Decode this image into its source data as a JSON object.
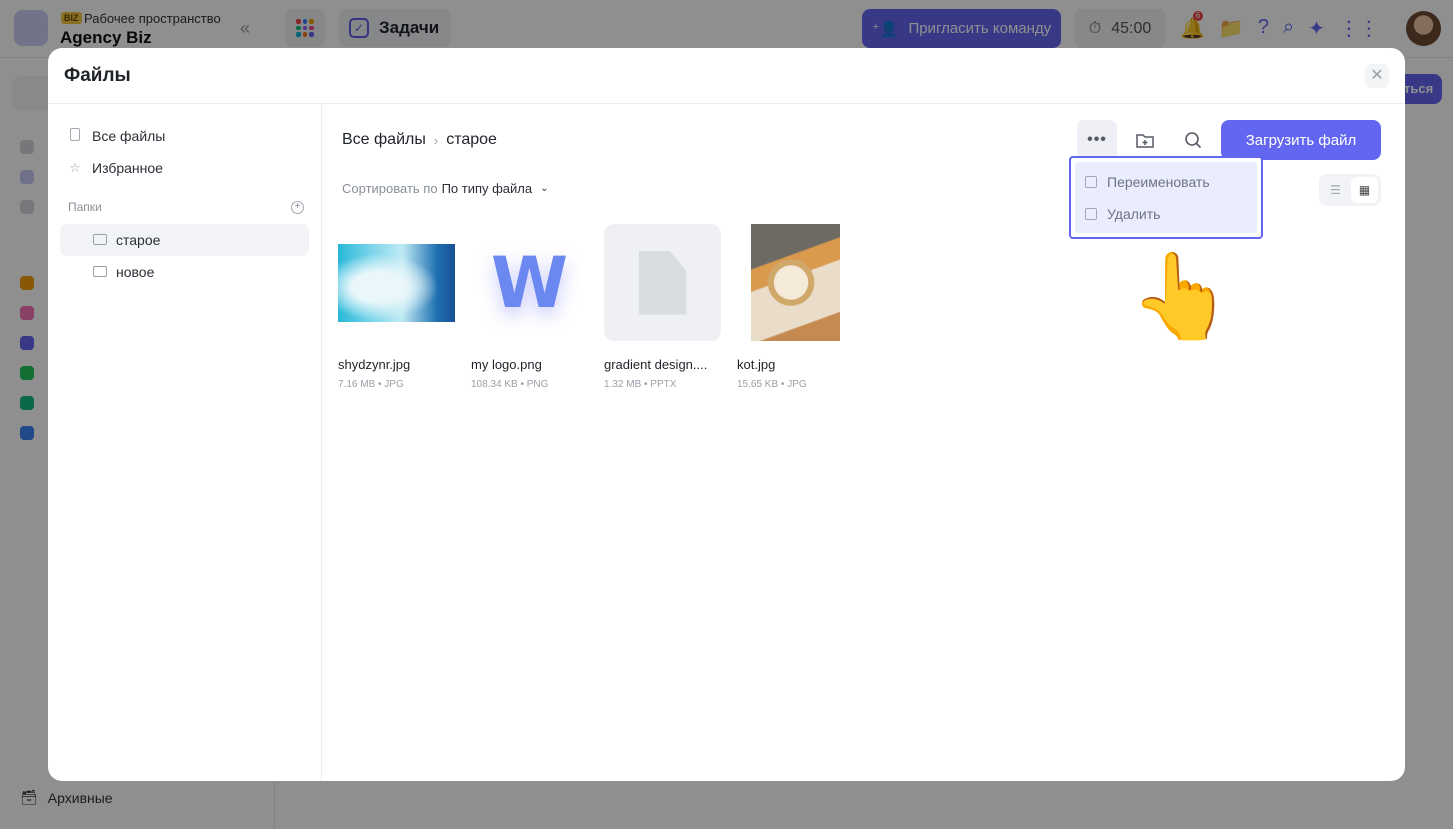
{
  "app": {
    "workspace_badge": "BIZ",
    "workspace_label": "Рабочее пространство",
    "workspace_name": "Agency Biz",
    "active_tab": "Задачи",
    "invite_label": "Пригласить команду",
    "timer": "45:00",
    "notifications_count": "6",
    "archived_label": "Архивные",
    "right_action_peek": "ться"
  },
  "modal": {
    "title": "Файлы",
    "sidebar": {
      "all_files": "Все файлы",
      "favorites": "Избранное",
      "folders_heading": "Папки",
      "folders": [
        {
          "name": "старое",
          "active": true
        },
        {
          "name": "новое",
          "active": false
        }
      ]
    },
    "breadcrumb": {
      "root": "Все файлы",
      "current": "старое"
    },
    "sort": {
      "label": "Сортировать по",
      "value": "По типу файла"
    },
    "toolbar": {
      "more_icon": "more-horizontal-icon",
      "new_folder_icon": "folder-plus-icon",
      "search_icon": "search-icon",
      "upload_label": "Загрузить файл"
    },
    "context_menu": {
      "rename": "Переименовать",
      "delete": "Удалить"
    },
    "files": [
      {
        "name": "shydzynr.jpg",
        "meta": "7.16 MB • JPG"
      },
      {
        "name": "my logo.png",
        "meta": "108.34 KB • PNG",
        "glyph": "W"
      },
      {
        "name": "gradient design....",
        "meta": "1.32 MB • PPTX"
      },
      {
        "name": "kot.jpg",
        "meta": "15.65 KB • JPG"
      }
    ]
  },
  "colors": {
    "accent": "#6366f1",
    "menu_highlight": "#eaedfb"
  }
}
